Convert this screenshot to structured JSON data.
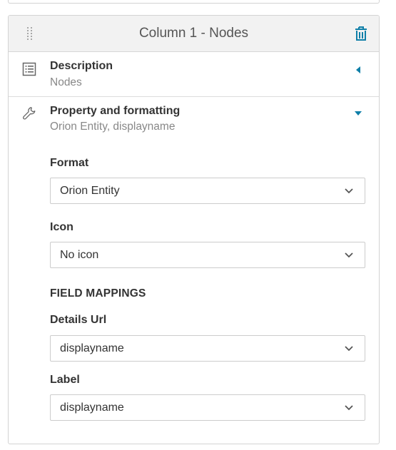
{
  "card": {
    "title": "Column 1 - Nodes"
  },
  "icons": {
    "drag": "drag-handle-icon",
    "trash": "trash-icon",
    "list": "list-icon",
    "wrench": "wrench-icon",
    "collapsed": "caret-left-icon",
    "expanded": "caret-down-icon",
    "select": "chevron-down-icon"
  },
  "colors": {
    "accent": "#0f7fa8",
    "header_bg": "#f2f2f2",
    "border": "#d3d3d3",
    "muted_text": "#888888"
  },
  "description": {
    "title": "Description",
    "value": "Nodes"
  },
  "property": {
    "title": "Property and formatting",
    "value": "Orion Entity, displayname",
    "format": {
      "label": "Format",
      "value": "Orion Entity"
    },
    "icon": {
      "label": "Icon",
      "value": "No icon"
    },
    "field_mappings": {
      "heading": "FIELD MAPPINGS",
      "details_url": {
        "label": "Details Url",
        "value": "displayname"
      },
      "label_field": {
        "label": "Label",
        "value": "displayname"
      }
    }
  }
}
